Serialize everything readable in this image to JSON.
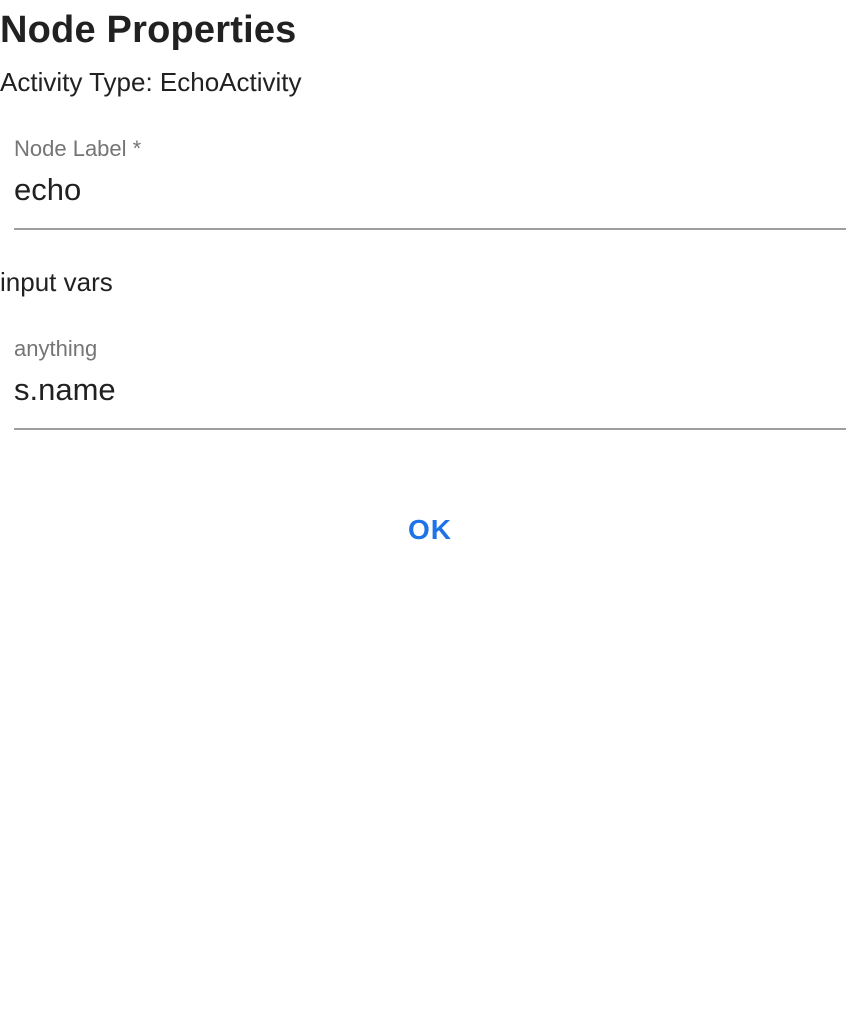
{
  "dialog": {
    "title": "Node Properties",
    "activity_type": "Activity Type: EchoActivity"
  },
  "fields": {
    "node_label": {
      "label": "Node Label *",
      "value": "echo"
    },
    "input_vars_heading": "input vars",
    "anything": {
      "label": "anything",
      "value": "s.name"
    }
  },
  "actions": {
    "ok_label": "OK"
  },
  "colors": {
    "accent": "#1e73e8",
    "label": "#757575",
    "text": "#212121",
    "underline": "#9e9e9e"
  }
}
